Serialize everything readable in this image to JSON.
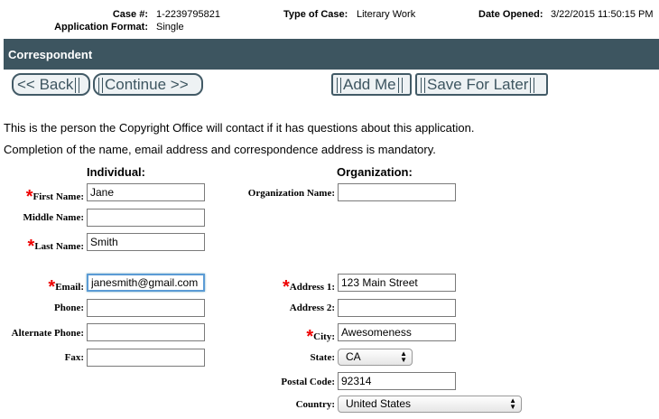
{
  "header": {
    "case_label": "Case #:",
    "case_value": "1-2239795821",
    "format_label": "Application Format:",
    "format_value": "Single",
    "type_label": "Type of Case:",
    "type_value": "Literary Work",
    "date_label": "Date Opened:",
    "date_value": "3/22/2015 11:50:15 PM"
  },
  "section_title": "Correspondent",
  "buttons": {
    "back": "<< Back",
    "continue": "Continue >>",
    "add_me": "Add Me",
    "save_later": "Save For Later"
  },
  "intro": {
    "line1": "This is the person the Copyright Office will contact if it has questions about this application.",
    "line2": "Completion of the name, email address and correspondence address is mandatory."
  },
  "individual": {
    "heading": "Individual:",
    "first_name_label": "First Name:",
    "first_name": "Jane",
    "middle_name_label": "Middle Name:",
    "middle_name": "",
    "last_name_label": "Last Name:",
    "last_name": "Smith",
    "email_label": "Email:",
    "email": "janesmith@gmail.com",
    "phone_label": "Phone:",
    "phone": "",
    "alt_phone_label": "Alternate Phone:",
    "alt_phone": "",
    "fax_label": "Fax:",
    "fax": ""
  },
  "organization": {
    "heading": "Organization:",
    "org_name_label": "Organization Name:",
    "org_name": "",
    "address1_label": "Address 1:",
    "address1": "123 Main Street",
    "address2_label": "Address 2:",
    "address2": "",
    "city_label": "City:",
    "city": "Awesomeness",
    "state_label": "State:",
    "state": "CA",
    "postal_label": "Postal Code:",
    "postal": "92314",
    "country_label": "Country:",
    "country": "United States"
  },
  "required_marker": "*",
  "colors": {
    "bar": "#3d5560",
    "required": "#e00000",
    "focus": "#5b9bd5"
  }
}
